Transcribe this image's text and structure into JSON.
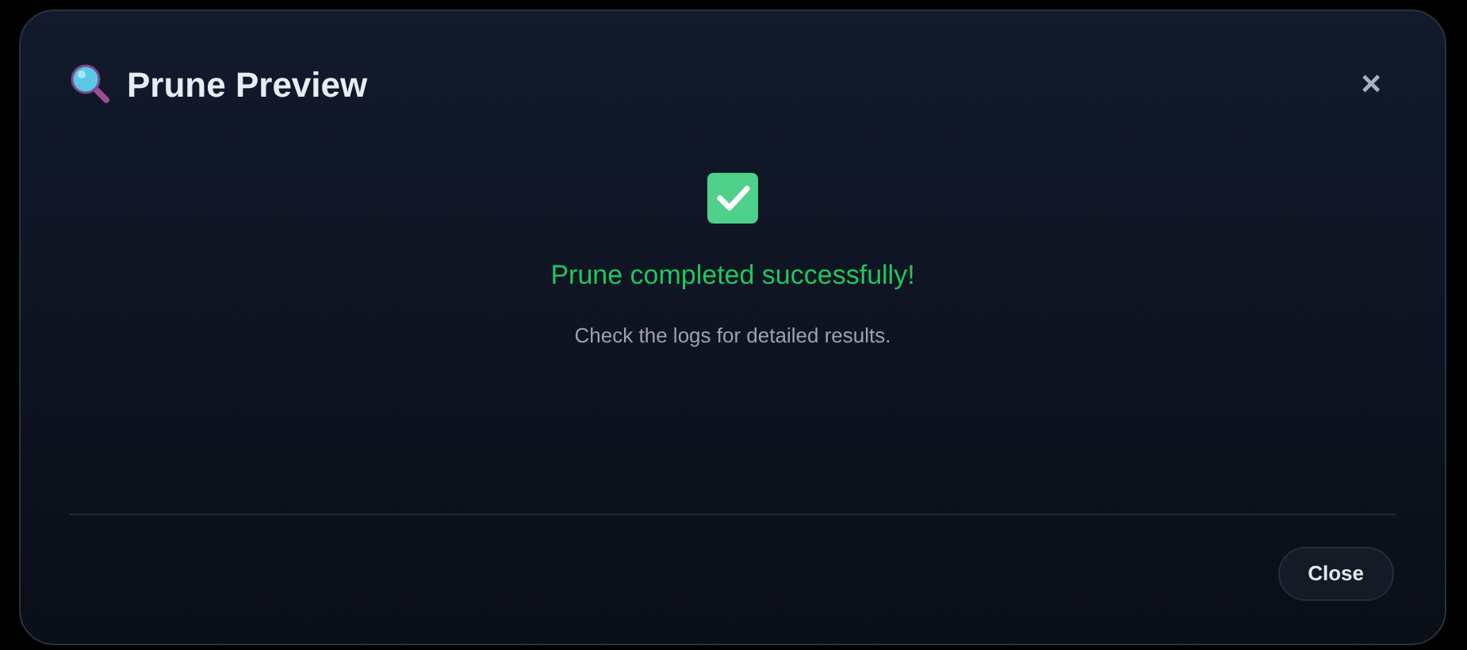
{
  "dialog": {
    "title": "Prune Preview",
    "close_glyph": "×"
  },
  "result": {
    "message": "Prune completed successfully!",
    "detail": "Check the logs for detailed results."
  },
  "buttons": [
    "Close"
  ]
}
